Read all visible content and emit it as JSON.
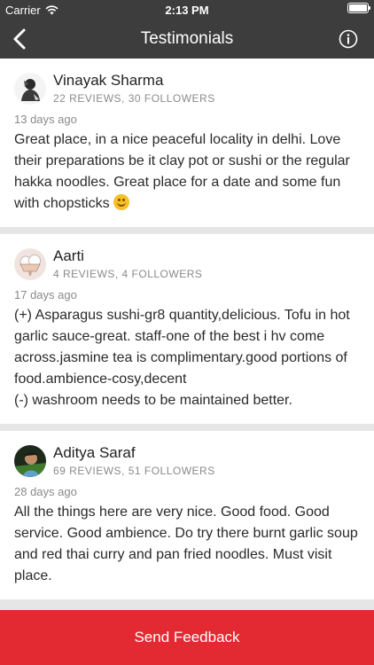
{
  "status_bar": {
    "carrier": "Carrier",
    "time": "2:13 PM",
    "battery_level": 1.0
  },
  "nav": {
    "title": "Testimonials",
    "back_icon": "chevron-left-icon",
    "info_icon": "info-circle-icon"
  },
  "reviews": [
    {
      "name": "Vinayak Sharma",
      "stats": "22 REVIEWS, 30 FOLLOWERS",
      "time": "13 days ago",
      "text": "Great place, in a nice peaceful locality in delhi.  Love their preparations be it clay pot or sushi or the regular hakka noodles. Great place for a date and some fun with chopsticks",
      "emoji": "smiling-face"
    },
    {
      "name": "Aarti",
      "stats": "4 REVIEWS, 4 FOLLOWERS",
      "time": "17 days ago",
      "text": "(+) Asparagus sushi-gr8 quantity,delicious. Tofu in hot garlic sauce-great. staff-one of the best i hv come across.jasmine tea is complimentary.good portions of food.ambience-cosy,decent\n(-) washroom needs to be maintained better."
    },
    {
      "name": "Aditya Saraf",
      "stats": "69 REVIEWS, 51 FOLLOWERS",
      "time": "28 days ago",
      "text": "All the things here are very nice. Good food. Good service. Good ambience. Do try there burnt garlic soup and red thai curry and pan fried noodles. Must visit place."
    }
  ],
  "footer": {
    "send_feedback_label": "Send Feedback"
  },
  "colors": {
    "bar_background": "#3d3d3d",
    "accent_red": "#e32932",
    "separator": "#e6e6e6"
  }
}
